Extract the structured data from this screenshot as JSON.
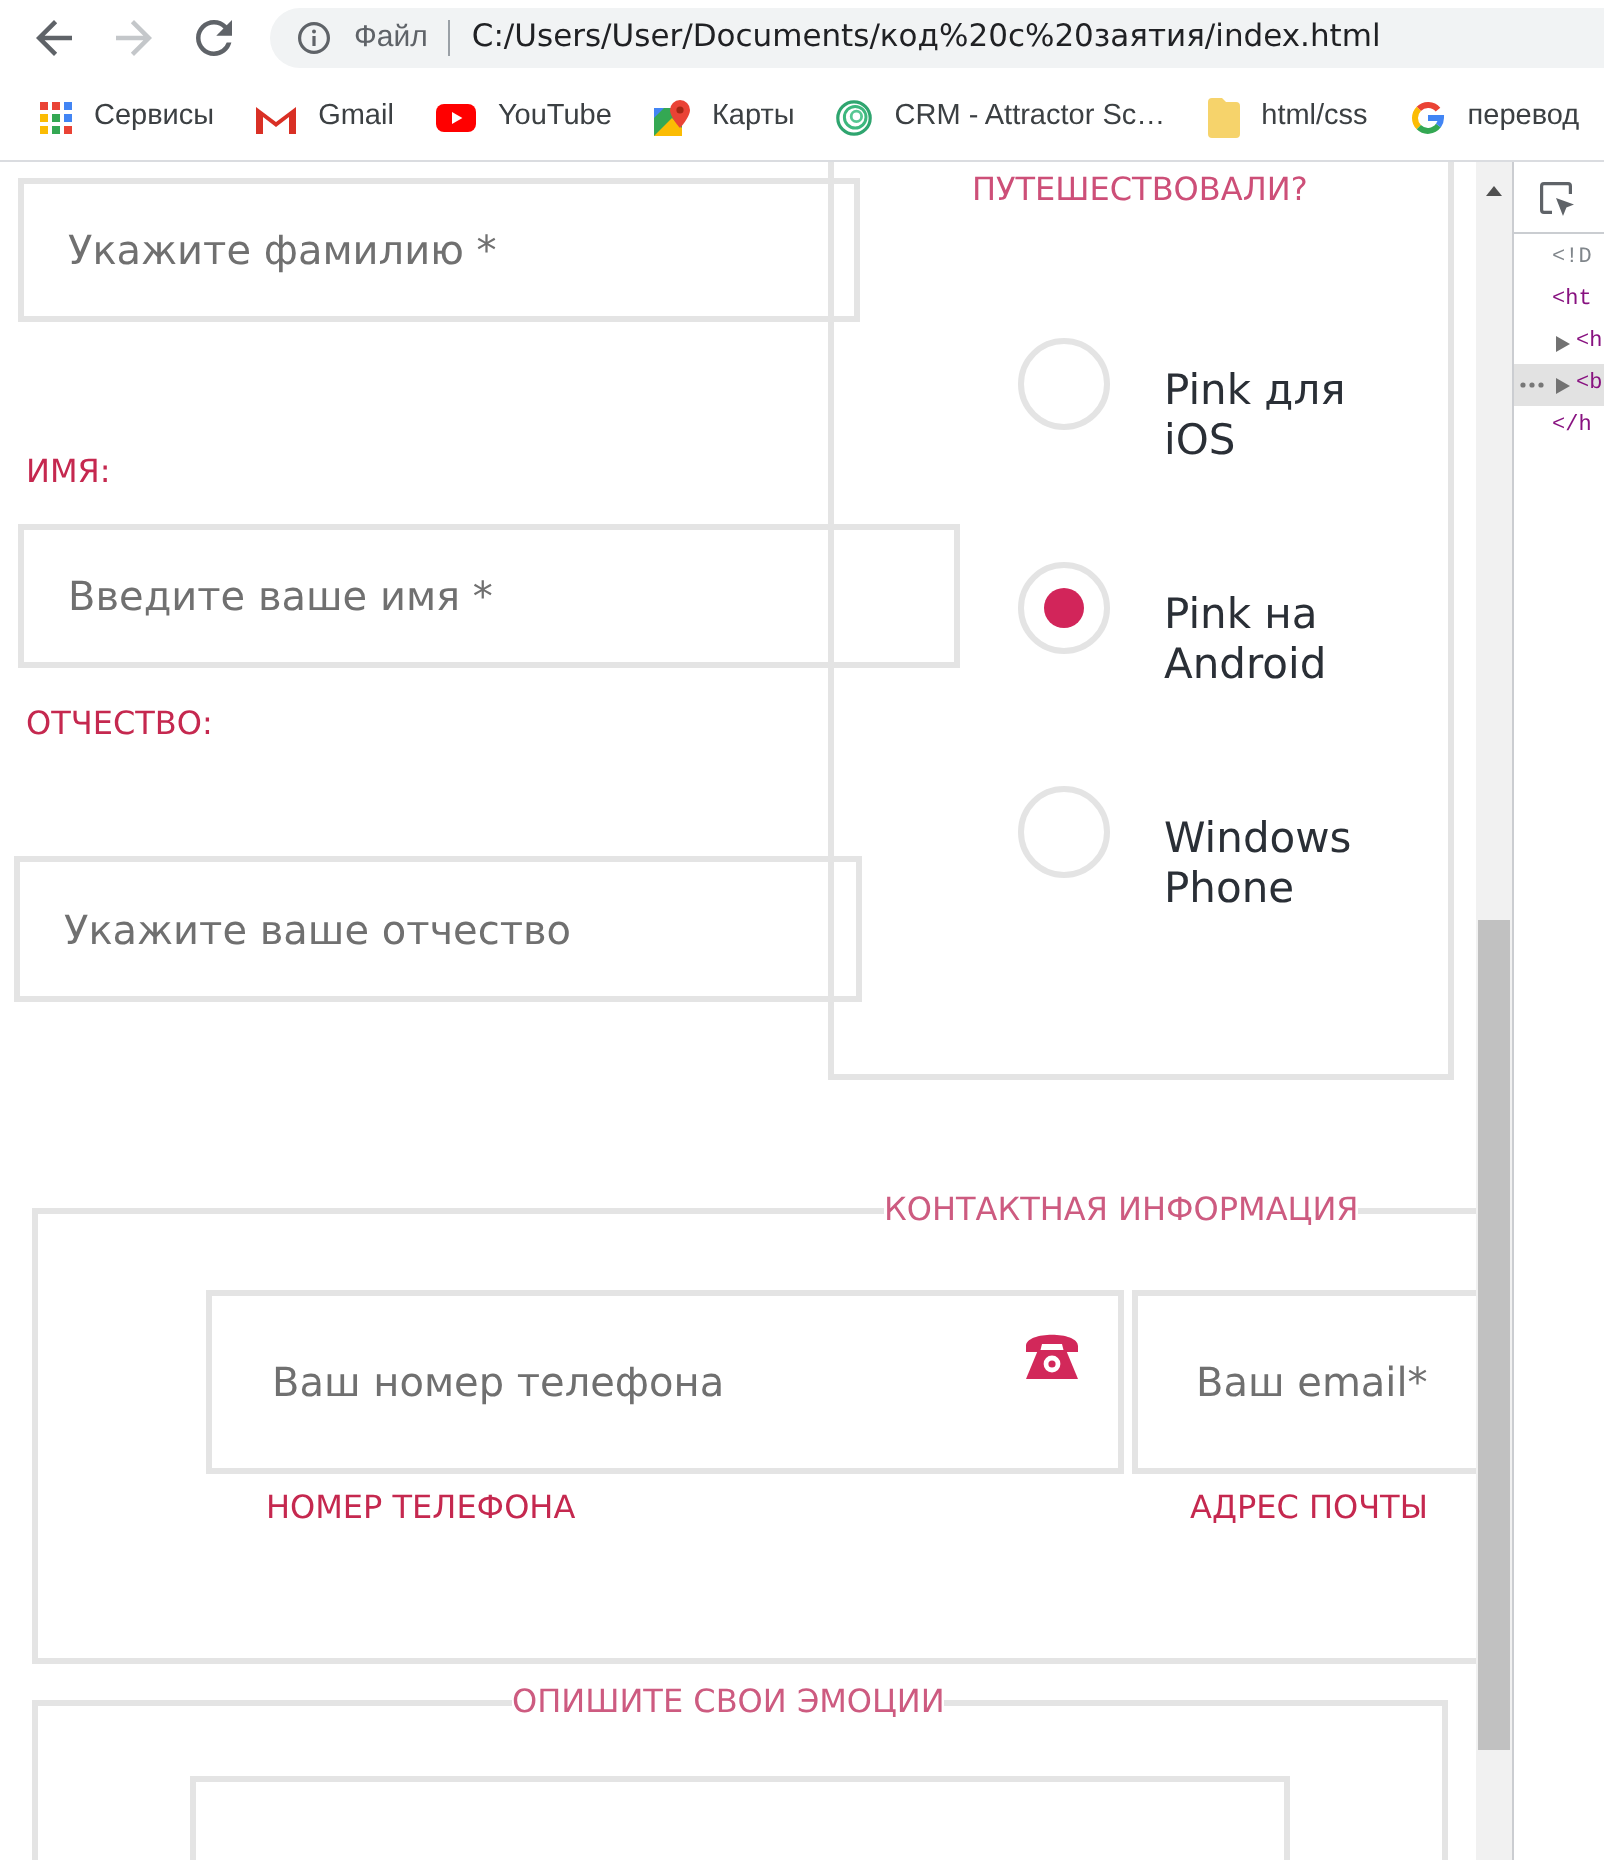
{
  "toolbar": [
    {
      "kind": "back",
      "disabled": false
    },
    {
      "kind": "forward",
      "disabled": true
    },
    {
      "kind": "reload",
      "disabled": false
    }
  ],
  "address_bar": {
    "scheme": "Файл",
    "url": "C:/Users/User/Documents/код%20с%20заятия/index.html"
  },
  "bookmarks": [
    {
      "kind": "grid",
      "label": "Сервисы"
    },
    {
      "kind": "mail",
      "label": "Gmail"
    },
    {
      "kind": "video",
      "label": "YouTube"
    },
    {
      "kind": "map",
      "label": "Карты"
    },
    {
      "kind": "spiral",
      "label": "CRM - Attractor Sc…"
    },
    {
      "kind": "folder",
      "label": "html/css"
    },
    {
      "kind": "g",
      "label": "перевод"
    }
  ],
  "form": {
    "surname": {
      "placeholder": "Укажите фамилию *"
    },
    "name": {
      "label": "ИМЯ:",
      "placeholder": "Введите ваше имя *"
    },
    "patronymic": {
      "label": "ОТЧЕСТВО:",
      "placeholder": "Укажите ваше отчество"
    },
    "travel": {
      "legend": "ПУТЕШЕСТВОВАЛИ?",
      "options": [
        {
          "label": "Pink для iOS",
          "selected": false
        },
        {
          "label": "Pink на Android",
          "selected": true
        },
        {
          "label": "Windows Phone",
          "selected": false
        }
      ]
    },
    "contacts": {
      "legend": "КОНТАКТНАЯ ИНФОРМАЦИЯ",
      "phone": {
        "placeholder": "Ваш номер телефона",
        "label": "НОМЕР ТЕЛЕФОНА"
      },
      "email": {
        "placeholder": "Ваш email*",
        "label": "АДРЕС ПОЧТЫ"
      }
    },
    "emotions": {
      "legend": "ОПИШИТЕ СВОИ ЭМОЦИИ"
    }
  },
  "devtools": {
    "nodes": [
      {
        "kind": "doctype",
        "text": "<!D",
        "expandable": false,
        "selected": false
      },
      {
        "kind": "tag",
        "text": "<ht",
        "expandable": false,
        "selected": false,
        "children": [
          {
            "kind": "tag",
            "text": "<h",
            "expandable": true,
            "selected": false
          },
          {
            "kind": "tag",
            "text": "<b",
            "expandable": true,
            "selected": true
          }
        ]
      },
      {
        "kind": "tag",
        "text": "</h",
        "expandable": false,
        "selected": false
      }
    ]
  }
}
